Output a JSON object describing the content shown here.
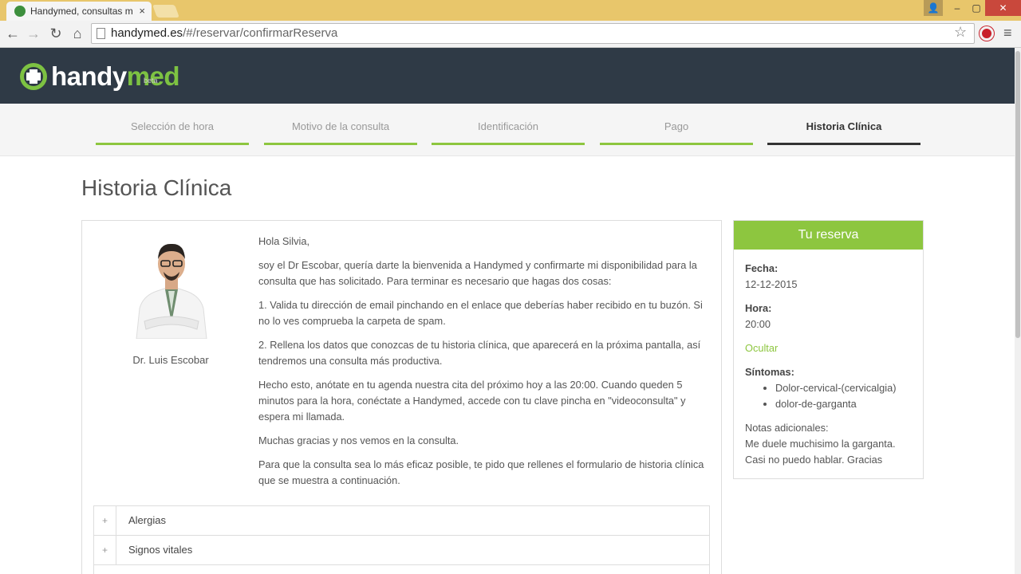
{
  "browser": {
    "tab_title": "Handymed, consultas méd",
    "tab_close": "×",
    "window": {
      "user": "👤",
      "minimize": "‒",
      "maximize": "▢",
      "close": "✕"
    },
    "nav": {
      "back": "←",
      "forward": "→",
      "reload": "↻",
      "home": "⌂"
    },
    "url_host": "handymed.es",
    "url_path": "/#/reservar/confirmarReserva",
    "star": "☆",
    "menu": "≡"
  },
  "header": {
    "logo_text_1": "handy",
    "logo_text_2": "med",
    "logo_beta": "beta"
  },
  "steps": [
    {
      "label": "Selección de hora"
    },
    {
      "label": "Motivo de la consulta"
    },
    {
      "label": "Identificación"
    },
    {
      "label": "Pago"
    },
    {
      "label": "Historia Clínica"
    }
  ],
  "page_title": "Historia Clínica",
  "doctor": {
    "name": "Dr. Luis Escobar"
  },
  "letter": {
    "p1": "Hola Silvia,",
    "p2": "soy el Dr Escobar, quería darte la bienvenida a Handymed y confirmarte mi disponibilidad para la consulta que has solicitado. Para terminar es necesario que hagas dos cosas:",
    "p3": "1. Valida tu dirección de email pinchando en el enlace que deberías haber recibido en tu buzón. Si no lo ves comprueba la carpeta de spam.",
    "p4": "2. Rellena los datos que conozcas de tu historia clínica, que aparecerá en la próxima pantalla, así tendremos una consulta más productiva.",
    "p5": "Hecho esto, anótate en tu agenda nuestra cita del próximo hoy a las 20:00. Cuando queden 5 minutos para la hora, conéctate a Handymed, accede con tu clave pincha en \"videoconsulta\" y espera mi llamada.",
    "p6": "Muchas gracias y nos vemos en la consulta.",
    "p7": "Para que la consulta sea lo más eficaz posible, te pido que rellenes el formulario de historia clínica que se muestra a continuación."
  },
  "accordion": [
    {
      "plus": "+",
      "label": "Alergias"
    },
    {
      "plus": "+",
      "label": "Signos vitales"
    }
  ],
  "reserva": {
    "title": "Tu reserva",
    "fecha_label": "Fecha:",
    "fecha": "12-12-2015",
    "hora_label": "Hora:",
    "hora": "20:00",
    "ocultar": "Ocultar",
    "sintomas_label": "Síntomas:",
    "sintomas": [
      "Dolor-cervical-(cervicalgia)",
      "dolor-de-garganta"
    ],
    "notas_label": "Notas adicionales:",
    "notas": "Me duele muchisimo la garganta. Casi no puedo hablar. Gracias"
  },
  "colors": {
    "brand_green": "#8dc63f",
    "header_dark": "#2f3a46"
  }
}
